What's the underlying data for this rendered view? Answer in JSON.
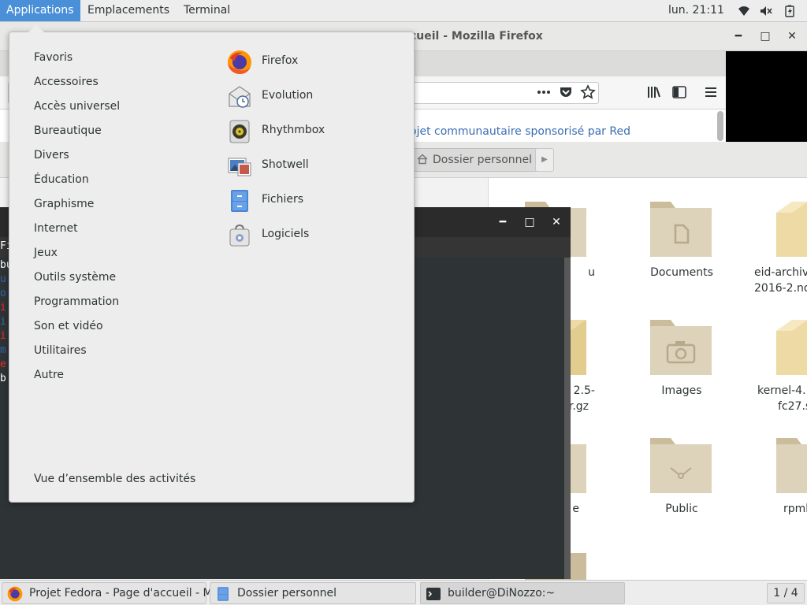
{
  "top_bar": {
    "menus": [
      "Applications",
      "Emplacements",
      "Terminal"
    ],
    "clock": "lun. 21:11",
    "tray_icons": [
      "wifi-icon",
      "volume-muted-icon",
      "battery-icon"
    ]
  },
  "firefox": {
    "title": "Projet Fedora - Page d'accueil - Mozilla Firefox",
    "title_visible": "cueil - Mozilla Firefox",
    "content_link": "ojet communautaire sponsorisé par Red",
    "icons": [
      "page-actions-icon",
      "pocket-icon",
      "bookmark-star-icon",
      "library-icon",
      "sidebar-icon",
      "hamburger-menu-icon"
    ]
  },
  "files": {
    "breadcrumb": "Dossier personnel",
    "items": [
      {
        "label": "u",
        "kind": "folder"
      },
      {
        "label": "Documents",
        "kind": "folder-documents"
      },
      {
        "label": "eid-archiv 2016-2.no",
        "line1": "eid-archiv",
        "line2": "2016-2.no",
        "kind": "package"
      },
      {
        "line1": "2.5-",
        "line2": "r.gz",
        "kind": "package"
      },
      {
        "label": "Images",
        "kind": "folder-pictures"
      },
      {
        "line1": "kernel-4.1",
        "line2": "fc27.sr",
        "kind": "package"
      },
      {
        "label": "e",
        "kind": "folder"
      },
      {
        "label": "Public",
        "kind": "folder-public"
      },
      {
        "label": "rpmb",
        "kind": "folder"
      }
    ]
  },
  "terminal": {
    "title": "builder@DiNozzo:~",
    "visible_fragments": [
      {
        "text": "Fi",
        "color": "#ffffff"
      },
      {
        "text": "bu",
        "color": "#ffffff"
      },
      {
        "text": "u",
        "color": "#3465a4"
      },
      {
        "text": "o",
        "color": "#3465a4"
      },
      {
        "text": "i",
        "color": "#ef2929"
      },
      {
        "text": "i",
        "color": "#3465a4"
      },
      {
        "text": "i",
        "color": "#ef2929"
      },
      {
        "text": "m",
        "color": "#3465a4"
      },
      {
        "text": "e",
        "color": "#ef2929"
      },
      {
        "text": "b",
        "color": "#ffffff"
      }
    ]
  },
  "applications_menu": {
    "categories": [
      "Favoris",
      "Accessoires",
      "Accès universel",
      "Bureautique",
      "Divers",
      "Éducation",
      "Graphisme",
      "Internet",
      "Jeux",
      "Outils système",
      "Programmation",
      "Son et vidéo",
      "Utilitaires",
      "Autre"
    ],
    "apps": [
      {
        "name": "Firefox",
        "icon": "firefox-icon"
      },
      {
        "name": "Evolution",
        "icon": "evolution-icon"
      },
      {
        "name": "Rhythmbox",
        "icon": "rhythmbox-icon"
      },
      {
        "name": "Shotwell",
        "icon": "shotwell-icon"
      },
      {
        "name": "Fichiers",
        "icon": "files-icon"
      },
      {
        "name": "Logiciels",
        "icon": "software-icon"
      }
    ],
    "overview": "Vue d’ensemble des activités"
  },
  "taskbar": {
    "tasks": [
      {
        "label": "Projet Fedora - Page d'accueil - Mo...",
        "icon": "firefox-icon"
      },
      {
        "label": "Dossier personnel",
        "icon": "files-icon"
      },
      {
        "label": "builder@DiNozzo:~",
        "icon": "terminal-icon"
      }
    ],
    "workspace": "1 / 4"
  },
  "colors": {
    "accent": "#4a90d9",
    "menu_bg": "#ededed",
    "terminal_bg": "#2e3436",
    "folder": "#d6cbb3",
    "link": "#3c6eb4"
  }
}
